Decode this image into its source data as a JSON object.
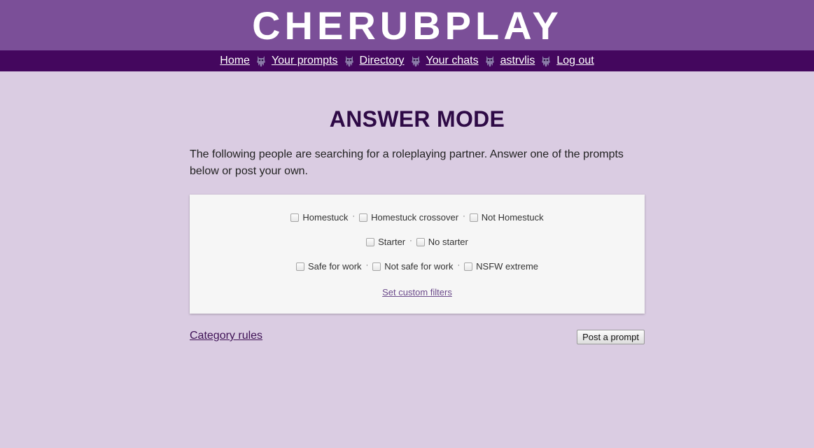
{
  "header": {
    "logo_text": "CHERUBPLAY",
    "logo_color": "#ffffff",
    "background": "#7b4f98"
  },
  "nav": {
    "background": "#44075e",
    "separator_icon": "imp-icon",
    "items": [
      {
        "label": "Home"
      },
      {
        "label": "Your prompts"
      },
      {
        "label": "Directory"
      },
      {
        "label": "Your chats"
      },
      {
        "label": "astrvlis"
      },
      {
        "label": "Log out"
      }
    ]
  },
  "main": {
    "title": "ANSWER MODE",
    "intro": "The following people are searching for a roleplaying partner. Answer one of the prompts below or post your own.",
    "filters": {
      "rows": [
        [
          {
            "label": "Homestuck",
            "checked": false
          },
          {
            "label": "Homestuck crossover",
            "checked": false
          },
          {
            "label": "Not Homestuck",
            "checked": false
          }
        ],
        [
          {
            "label": "Starter",
            "checked": false
          },
          {
            "label": "No starter",
            "checked": false
          }
        ],
        [
          {
            "label": "Safe for work",
            "checked": false
          },
          {
            "label": "Not safe for work",
            "checked": false
          },
          {
            "label": "NSFW extreme",
            "checked": false
          }
        ]
      ],
      "separator": "·",
      "custom_filters_link": "Set custom filters"
    },
    "category_rules_link": "Category rules",
    "post_prompt_button": "Post a prompt"
  }
}
